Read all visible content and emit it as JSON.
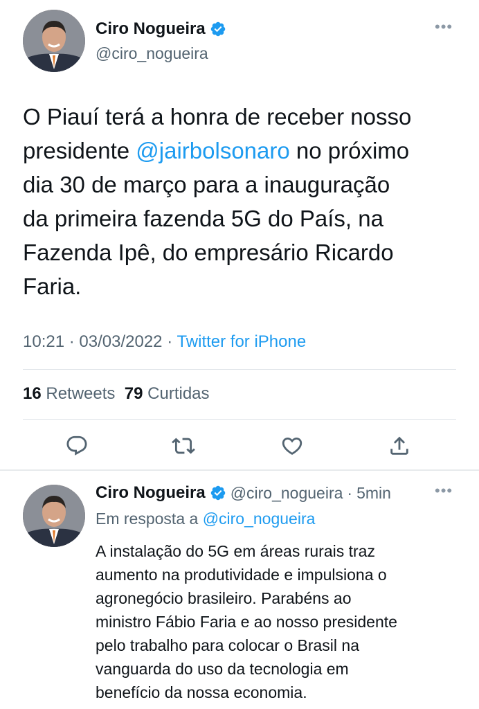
{
  "main_tweet": {
    "author_name": "Ciro Nogueira",
    "author_handle": "@ciro_nogueira",
    "text_before_mention": "O Piauí terá a honra de receber nosso\npresidente ",
    "mention": "@jairbolsonaro",
    "text_after_mention": " no próximo\ndia 30 de março para a inauguração\nda primeira fazenda 5G do País, na\nFazenda Ipê, do empresário Ricardo\nFaria.",
    "time": "10:21",
    "date": "03/03/2022",
    "source": "Twitter for iPhone",
    "retweets_count": "16",
    "retweets_label": "Retweets",
    "likes_count": "79",
    "likes_label": "Curtidas",
    "more_glyph": "•••"
  },
  "reply_tweet": {
    "author_name": "Ciro Nogueira",
    "author_handle": "@ciro_nogueira",
    "time_ago": "5min",
    "reply_prefix": "Em resposta a",
    "reply_to_handle": "@ciro_nogueira",
    "text": "A instalação do 5G em áreas rurais traz\naumento na produtividade e impulsiona o\nagronegócio brasileiro. Parabéns ao\nministro Fábio Faria e ao nosso presidente\npelo trabalho para colocar o Brasil na\nvanguarda do uso da tecnologia em\nbenefício da nossa economia.",
    "more_glyph": "•••"
  },
  "icons": {
    "reply": "reply-icon",
    "retweet": "retweet-icon",
    "like": "heart-icon",
    "share": "share-icon",
    "verified": "verified-badge-icon"
  },
  "colors": {
    "accent": "#1d9bf0",
    "text_primary": "#0f1419",
    "text_secondary": "#536471",
    "divider": "#dfe4e8"
  }
}
